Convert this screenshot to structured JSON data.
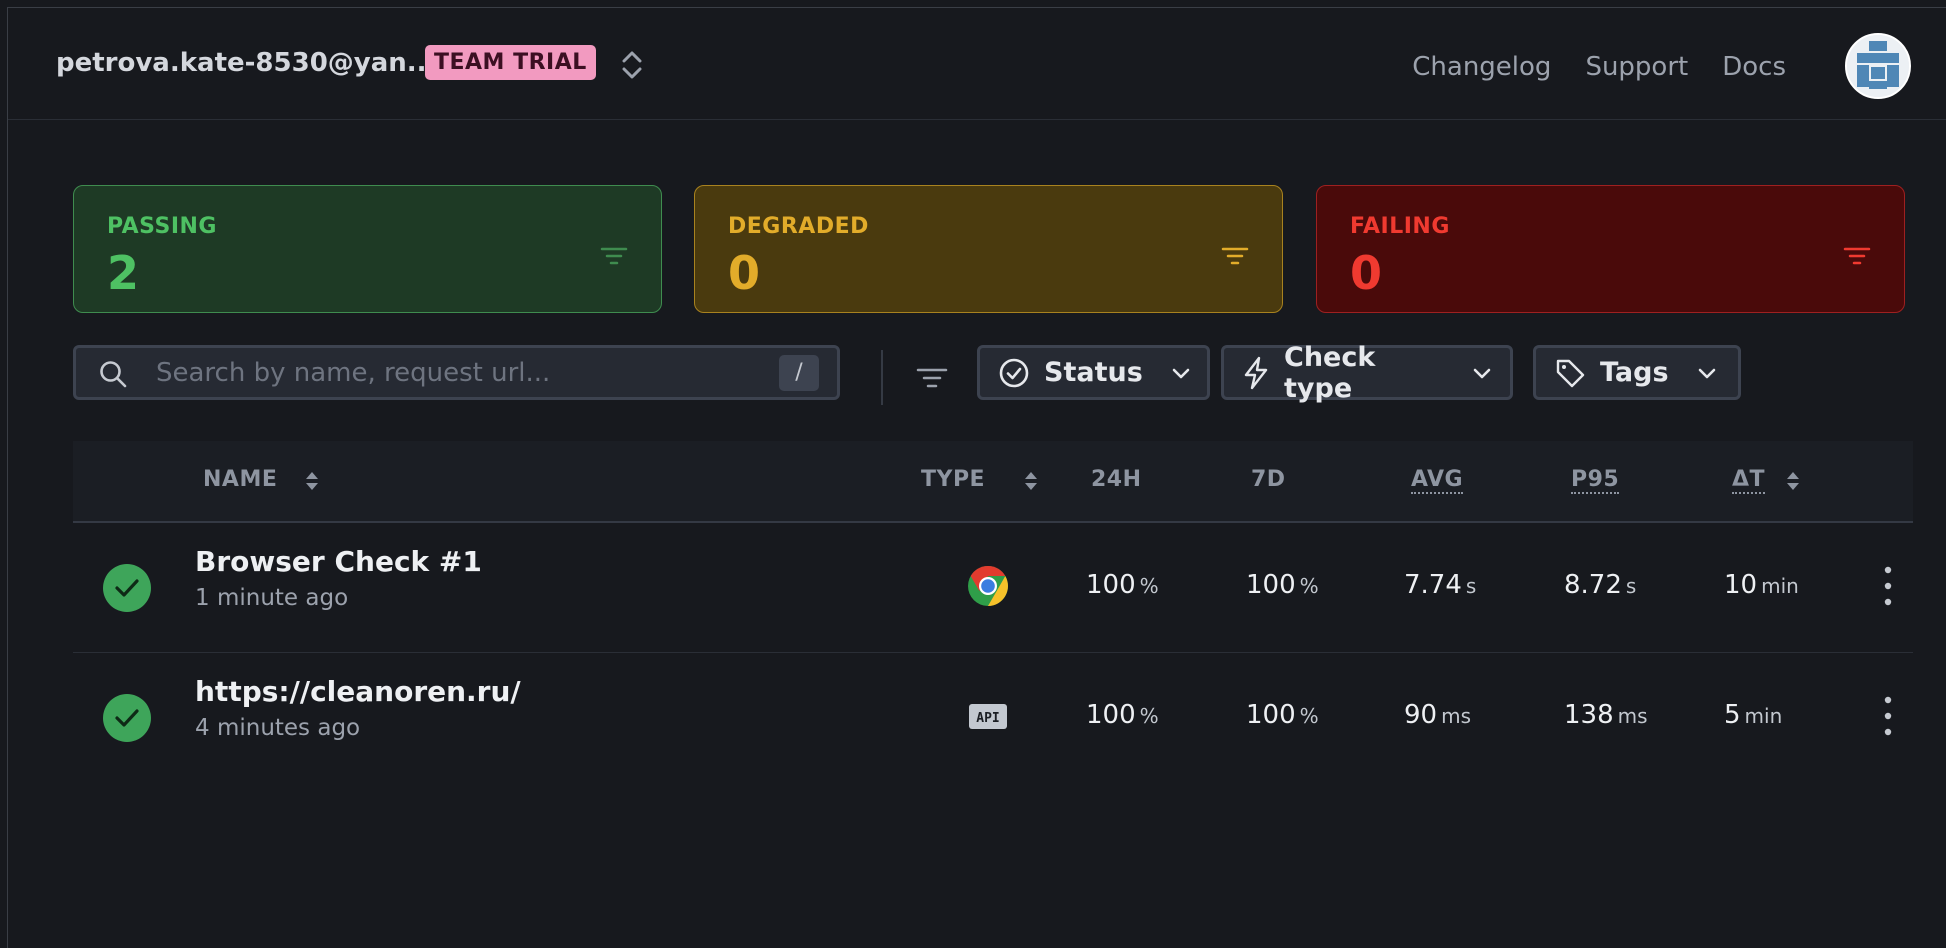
{
  "topbar": {
    "account_email": "petrova.kate-8530@yan...",
    "plan_badge": "TEAM TRIAL",
    "links": [
      "Changelog",
      "Support",
      "Docs"
    ]
  },
  "summary_cards": [
    {
      "label": "PASSING",
      "count": "2",
      "color": "#4ec163"
    },
    {
      "label": "DEGRADED",
      "count": "0",
      "color": "#e2ac2a"
    },
    {
      "label": "FAILING",
      "count": "0",
      "color": "#f03a30"
    }
  ],
  "search": {
    "placeholder": "Search by name, request url...",
    "value": "",
    "shortcut": "/"
  },
  "filters": {
    "status_label": "Status",
    "check_type_label": "Check type",
    "tags_label": "Tags"
  },
  "table": {
    "headers": {
      "name": "NAME",
      "type": "TYPE",
      "h24": "24H",
      "d7": "7D",
      "avg": "AVG",
      "p95": "P95",
      "dt": "ΔT"
    },
    "rows": [
      {
        "name": "Browser Check #1",
        "time": "1 minute ago",
        "type_icon": "chrome-icon",
        "h24": "100",
        "h24_unit": "%",
        "d7": "100",
        "d7_unit": "%",
        "avg": "7.74",
        "avg_unit": "s",
        "p95": "8.72",
        "p95_unit": "s",
        "dt": "10",
        "dt_unit": "min"
      },
      {
        "name": "https://cleanoren.ru/",
        "time": "4 minutes ago",
        "type_icon": "api-icon",
        "type_text": "API",
        "h24": "100",
        "h24_unit": "%",
        "d7": "100",
        "d7_unit": "%",
        "avg": "90",
        "avg_unit": "ms",
        "p95": "138",
        "p95_unit": "ms",
        "dt": "5",
        "dt_unit": "min"
      }
    ]
  },
  "colors": {
    "background": "#17191e",
    "passing": "#4ec163",
    "degraded": "#e2ac2a",
    "failing": "#f03a30",
    "trial_badge": "#f29ac0",
    "success_dot": "#3ea55a"
  }
}
